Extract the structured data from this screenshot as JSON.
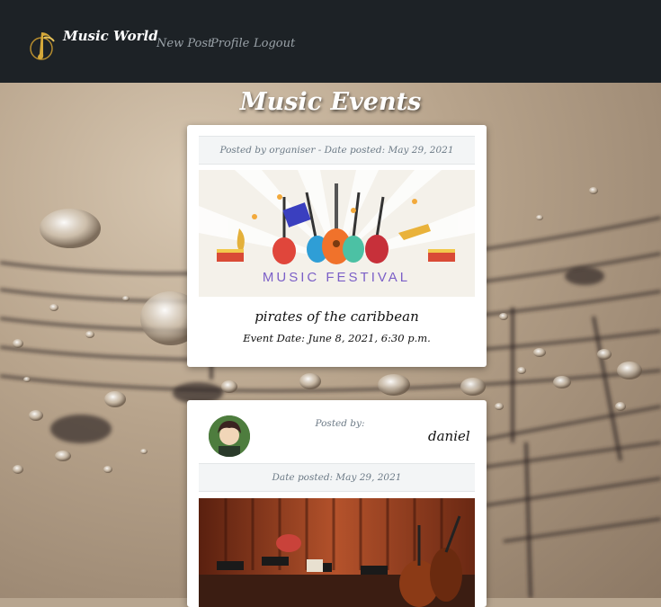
{
  "navbar": {
    "brand": "Music World",
    "links": [
      "New Post",
      "Profile",
      "Logout"
    ]
  },
  "page": {
    "title": "Music Events"
  },
  "posts": [
    {
      "meta": "Posted by organiser - Date posted: May 29, 2021",
      "image_text": "MUSIC FESTIVAL",
      "title": "pirates of the caribbean",
      "event_date": "Event Date: June 8, 2021, 6:30 p.m."
    },
    {
      "posted_by_label": "Posted by:",
      "username": "daniel",
      "date_posted": "Date posted: May 29, 2021"
    }
  ],
  "colors": {
    "navbar_bg": "#1d2226",
    "nav_link": "#9aa2a8",
    "meta_text": "#6c7a86"
  }
}
